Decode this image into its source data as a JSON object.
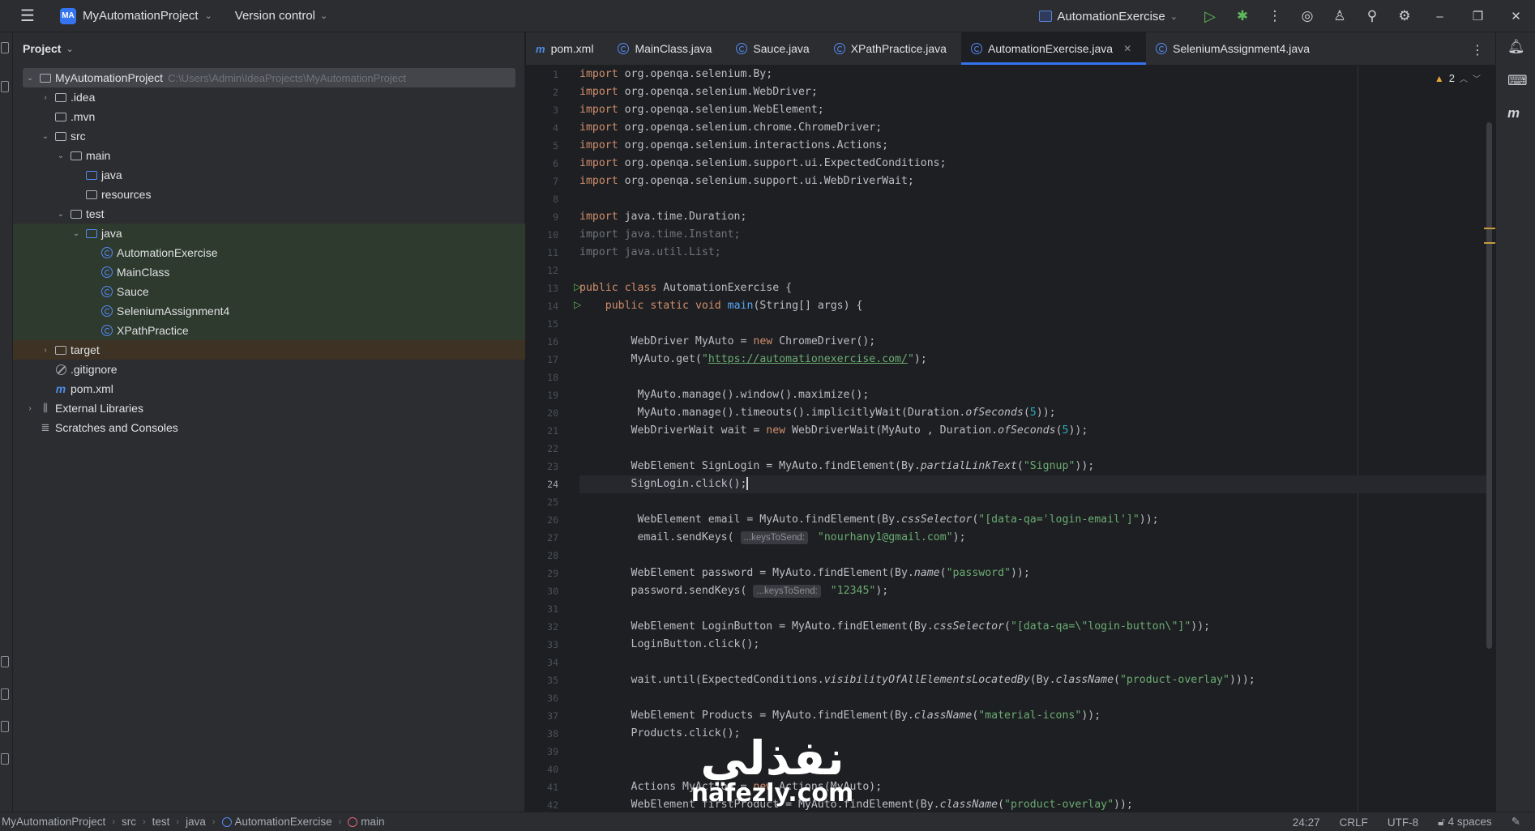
{
  "titlebar": {
    "project_badge": "MA",
    "project_name": "MyAutomationProject",
    "vcs": "Version control",
    "run_config": "AutomationExercise"
  },
  "project_panel": {
    "title": "Project",
    "root_path": "C:\\Users\\Admin\\IdeaProjects\\MyAutomationProject",
    "tree": [
      {
        "label": "MyAutomationProject",
        "depth": 0,
        "kind": "module",
        "expanded": true,
        "state": "selected"
      },
      {
        "label": ".idea",
        "depth": 1,
        "kind": "folder",
        "expanded": false
      },
      {
        "label": ".mvn",
        "depth": 1,
        "kind": "folder"
      },
      {
        "label": "src",
        "depth": 1,
        "kind": "folder",
        "expanded": true
      },
      {
        "label": "main",
        "depth": 2,
        "kind": "folder",
        "expanded": true
      },
      {
        "label": "java",
        "depth": 3,
        "kind": "source-folder"
      },
      {
        "label": "resources",
        "depth": 3,
        "kind": "resources-folder"
      },
      {
        "label": "test",
        "depth": 2,
        "kind": "folder",
        "expanded": true
      },
      {
        "label": "java",
        "depth": 3,
        "kind": "test-folder",
        "expanded": true,
        "state": "green"
      },
      {
        "label": "AutomationExercise",
        "depth": 4,
        "kind": "class",
        "state": "green"
      },
      {
        "label": "MainClass",
        "depth": 4,
        "kind": "class",
        "state": "green"
      },
      {
        "label": "Sauce",
        "depth": 4,
        "kind": "class",
        "state": "green"
      },
      {
        "label": "SeleniumAssignment4",
        "depth": 4,
        "kind": "class",
        "state": "green"
      },
      {
        "label": "XPathPractice",
        "depth": 4,
        "kind": "class",
        "state": "green"
      },
      {
        "label": "target",
        "depth": 1,
        "kind": "folder",
        "expanded": false,
        "state": "orange"
      },
      {
        "label": ".gitignore",
        "depth": 1,
        "kind": "gitignore"
      },
      {
        "label": "pom.xml",
        "depth": 1,
        "kind": "maven"
      },
      {
        "label": "External Libraries",
        "depth": 0,
        "kind": "library",
        "expanded": false
      },
      {
        "label": "Scratches and Consoles",
        "depth": 0,
        "kind": "scratches"
      }
    ]
  },
  "tabs": [
    {
      "label": "pom.xml",
      "icon": "maven-icon",
      "active": false
    },
    {
      "label": "MainClass.java",
      "icon": "class-icon",
      "active": false
    },
    {
      "label": "Sauce.java",
      "icon": "class-icon",
      "active": false
    },
    {
      "label": "XPathPractice.java",
      "icon": "class-icon",
      "active": false
    },
    {
      "label": "AutomationExercise.java",
      "icon": "class-icon",
      "active": true
    },
    {
      "label": "SeleniumAssignment4.java",
      "icon": "class-icon",
      "active": false
    }
  ],
  "editor": {
    "warnings_count": "2",
    "current_line": 24,
    "lines": [
      "import org.openqa.selenium.By;",
      "import org.openqa.selenium.WebDriver;",
      "import org.openqa.selenium.WebElement;",
      "import org.openqa.selenium.chrome.ChromeDriver;",
      "import org.openqa.selenium.interactions.Actions;",
      "import org.openqa.selenium.support.ui.ExpectedConditions;",
      "import org.openqa.selenium.support.ui.WebDriverWait;",
      "",
      "import java.time.Duration;",
      "import java.time.Instant;",
      "import java.util.List;",
      "",
      "public class AutomationExercise {",
      "    public static void main(String[] args) {",
      "",
      "        WebDriver MyAuto = new ChromeDriver();",
      "        MyAuto.get(\"https://automationexercise.com/\");",
      "",
      "         MyAuto.manage().window().maximize();",
      "         MyAuto.manage().timeouts().implicitlyWait(Duration.ofSeconds(5));",
      "        WebDriverWait wait = new WebDriverWait(MyAuto , Duration.ofSeconds(5));",
      "",
      "        WebElement SignLogin = MyAuto.findElement(By.partialLinkText(\"Signup\"));",
      "        SignLogin.click();",
      "",
      "         WebElement email = MyAuto.findElement(By.cssSelector(\"[data-qa='login-email']\"));",
      "         email.sendKeys( ...keysToSend: \"nourhany1@gmail.com\");",
      "",
      "        WebElement password = MyAuto.findElement(By.name(\"password\"));",
      "        password.sendKeys( ...keysToSend: \"12345\");",
      "",
      "        WebElement LoginButton = MyAuto.findElement(By.cssSelector(\"[data-qa=\\\"login-button\\\"]\"));",
      "        LoginButton.click();",
      "",
      "        wait.until(ExpectedConditions.visibilityOfAllElementsLocatedBy(By.className(\"product-overlay\")));",
      "",
      "        WebElement Products = MyAuto.findElement(By.className(\"material-icons\"));",
      "        Products.click();",
      "",
      "",
      "        Actions MyAction = new Actions(MyAuto);",
      "        WebElement firstProduct = MyAuto.findElement(By.className(\"product-overlay\"));"
    ]
  },
  "statusbar": {
    "breadcrumbs": [
      "MyAutomationProject",
      "src",
      "test",
      "java",
      "AutomationExercise",
      "main"
    ],
    "position": "24:27",
    "line_sep": "CRLF",
    "encoding": "UTF-8",
    "indent": "4 spaces"
  },
  "watermark": {
    "arabic": "نفذلي",
    "latin": "nafezly.com"
  },
  "colors": {
    "accent": "#3574f0",
    "keyword": "#cf8e6d",
    "string": "#6aab73",
    "number": "#2aacb8",
    "method": "#56a8f5",
    "run_green": "#5fb85a"
  }
}
